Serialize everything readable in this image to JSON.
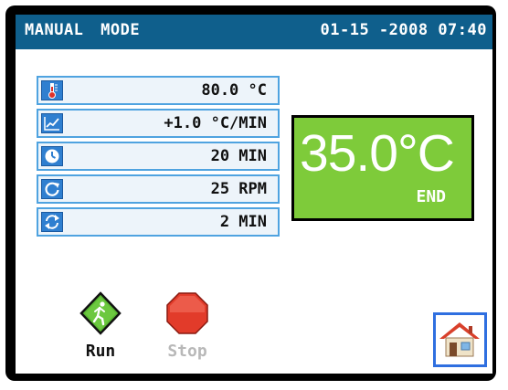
{
  "header": {
    "mode": "MANUAL  MODE",
    "datetime": "01-15 -2008 07:40"
  },
  "params": [
    {
      "icon": "thermometer-icon",
      "value": "80.0 °C"
    },
    {
      "icon": "rate-chart-icon",
      "value": "+1.0 °C/MIN"
    },
    {
      "icon": "clock-icon",
      "value": "20  MIN"
    },
    {
      "icon": "rotation-icon",
      "value": "25  RPM"
    },
    {
      "icon": "cycle-icon",
      "value": "2  MIN"
    }
  ],
  "status": {
    "temperature": "35.0°C",
    "state": "END",
    "color": "#7ecb3a"
  },
  "controls": {
    "run_label": "Run",
    "stop_label": "Stop"
  },
  "colors": {
    "header_bg": "#0f5f8c",
    "row_border": "#4fa3e0",
    "home_border": "#2f6fe0"
  }
}
